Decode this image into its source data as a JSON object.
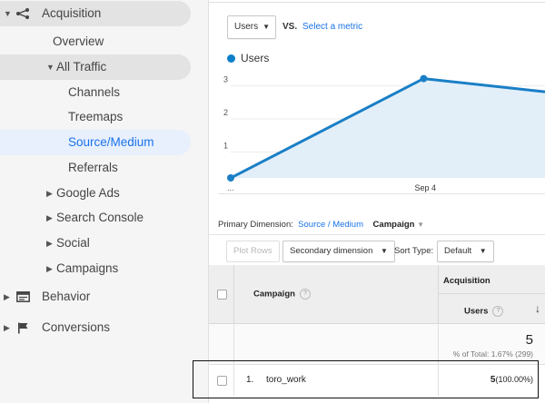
{
  "sidebar": {
    "acquisition": "Acquisition",
    "overview": "Overview",
    "all_traffic": "All Traffic",
    "channels": "Channels",
    "treemaps": "Treemaps",
    "source_medium": "Source/Medium",
    "referrals": "Referrals",
    "google_ads": "Google Ads",
    "search_console": "Search Console",
    "social": "Social",
    "campaigns": "Campaigns",
    "behavior": "Behavior",
    "conversions": "Conversions"
  },
  "chart_controls": {
    "metric_select": "Users",
    "vs": "VS.",
    "select_metric": "Select a metric"
  },
  "chart_data": {
    "type": "line",
    "series": [
      {
        "name": "Users",
        "values": [
          0,
          3,
          2.6
        ]
      }
    ],
    "x": [
      "",
      "Sep 4",
      ""
    ],
    "x_tick_labels": [
      "...",
      "Sep 4"
    ],
    "y_ticks": [
      "3",
      "2",
      "1"
    ],
    "ylim": [
      0,
      3.4
    ],
    "color": "#1a7fc6",
    "fill": "#e2eff9"
  },
  "primary_dimension": {
    "label": "Primary Dimension:",
    "source_medium": "Source / Medium",
    "campaign": "Campaign"
  },
  "toolbar": {
    "plot_rows": "Plot Rows",
    "secondary_dimension": "Secondary dimension",
    "sort_type_label": "Sort Type:",
    "sort_type_value": "Default"
  },
  "table": {
    "campaign_header": "Campaign",
    "acquisition_header": "Acquisition",
    "users_header": "Users",
    "total_users": "5",
    "total_pct": "% of Total: 1.67% (299)",
    "rows": [
      {
        "index": "1.",
        "campaign": "toro_work",
        "users": "5",
        "users_pct": "(100.00%)"
      }
    ]
  },
  "colors": {
    "accent": "#1a73e8",
    "line": "#1a7fc6",
    "selected_bg": "#e8f0fe"
  }
}
